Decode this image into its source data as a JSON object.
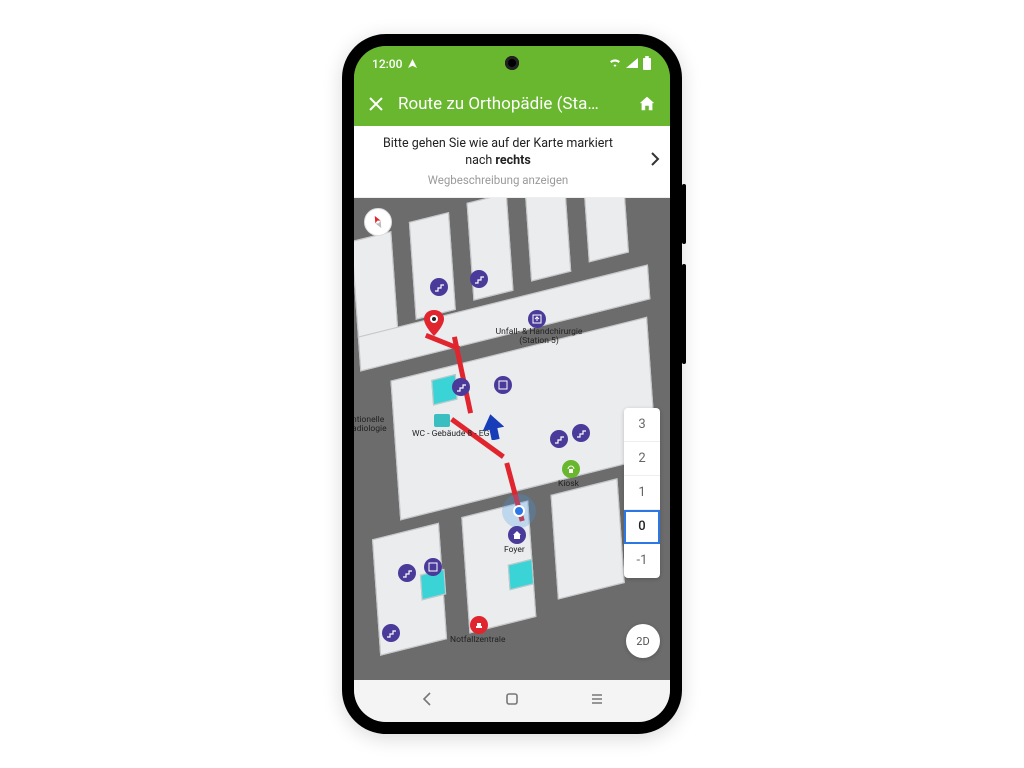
{
  "status": {
    "time": "12:00",
    "wifi_icon": "wifi",
    "battery_icon": "battery"
  },
  "appbar": {
    "close_icon": "close",
    "title": "Route zu Orthopädie (Sta…",
    "home_icon": "home"
  },
  "instruction": {
    "main_prefix": "Bitte gehen Sie wie auf der Karte markiert nach ",
    "main_bold": "rechts",
    "sub": "Wegbeschreibung anzeigen",
    "expand_icon": "chevron-right"
  },
  "map": {
    "compass_icon": "compass",
    "view_toggle": "2D",
    "labels": {
      "station5": "Unfall- & Handchirurgie\n(Station 5)",
      "radiologie": "ntionelle\nadiologie",
      "wc": "WC - Gebäude 8 - EG",
      "kiosk": "Kiosk",
      "foyer": "Foyer",
      "notfall": "Notfallzentrale"
    },
    "floors": [
      {
        "label": "3",
        "active": false
      },
      {
        "label": "2",
        "active": false
      },
      {
        "label": "1",
        "active": false
      },
      {
        "label": "0",
        "active": true
      },
      {
        "label": "-1",
        "active": false
      }
    ]
  },
  "sysnav": {
    "back_icon": "back",
    "home_icon": "home-outline",
    "recent_icon": "recent"
  },
  "colors": {
    "accent": "#68b72f",
    "route": "#e0252f",
    "location": "#2b78e4",
    "poi": "#4a3a9a"
  }
}
